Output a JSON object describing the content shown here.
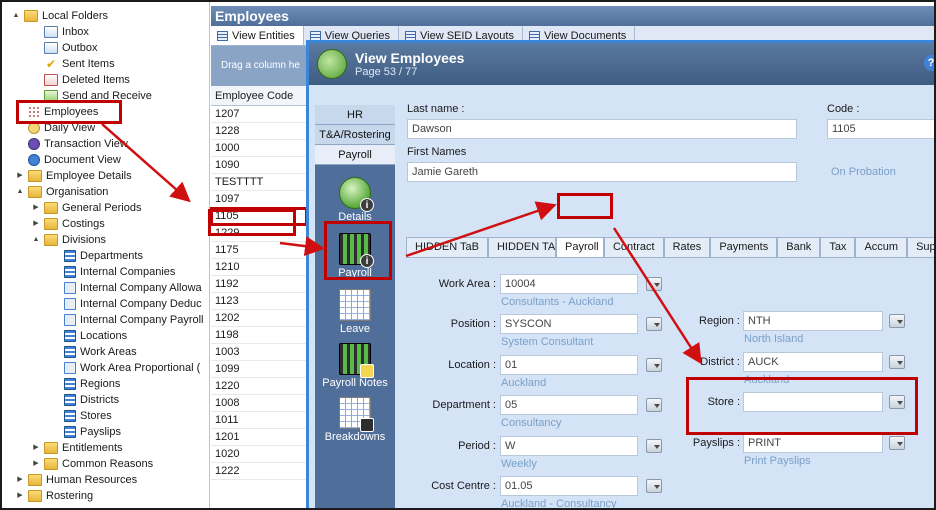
{
  "tree": {
    "items": [
      {
        "label": "Local Folders",
        "icon": "folder-icon",
        "toggle": "▲"
      },
      {
        "label": "Inbox",
        "icon": "inbox-icon",
        "toggle": ""
      },
      {
        "label": "Outbox",
        "icon": "outbox-icon",
        "toggle": ""
      },
      {
        "label": "Sent Items",
        "icon": "sent-items-icon",
        "toggle": ""
      },
      {
        "label": "Deleted Items",
        "icon": "deleted-items-icon",
        "toggle": ""
      },
      {
        "label": "Send and Receive",
        "icon": "send-receive-icon",
        "toggle": ""
      },
      {
        "label": "Employees",
        "icon": "employees-grid-icon",
        "toggle": ""
      },
      {
        "label": "Daily View",
        "icon": "clock-icon",
        "toggle": ""
      },
      {
        "label": "Transaction View",
        "icon": "transaction-icon",
        "toggle": ""
      },
      {
        "label": "Document View",
        "icon": "document-view-icon",
        "toggle": ""
      },
      {
        "label": "Employee Details",
        "icon": "folder-icon",
        "toggle": "▶"
      },
      {
        "label": "Organisation",
        "icon": "folder-icon",
        "toggle": "▲"
      },
      {
        "label": "General Periods",
        "icon": "folder-icon",
        "toggle": "▶"
      },
      {
        "label": "Costings",
        "icon": "folder-icon",
        "toggle": "▶"
      },
      {
        "label": "Divisions",
        "icon": "folder-icon",
        "toggle": "▲"
      },
      {
        "label": "Departments",
        "icon": "list-icon",
        "toggle": ""
      },
      {
        "label": "Internal Companies",
        "icon": "list-icon",
        "toggle": ""
      },
      {
        "label": "Internal Company Allowa",
        "icon": "flow-icon",
        "toggle": ""
      },
      {
        "label": "Internal Company Deduc",
        "icon": "flow-icon",
        "toggle": ""
      },
      {
        "label": "Internal Company Payroll",
        "icon": "flow-icon",
        "toggle": ""
      },
      {
        "label": "Locations",
        "icon": "list-icon",
        "toggle": ""
      },
      {
        "label": "Work Areas",
        "icon": "list-icon",
        "toggle": ""
      },
      {
        "label": "Work Area Proportional (",
        "icon": "flow-icon",
        "toggle": ""
      },
      {
        "label": "Regions",
        "icon": "list-icon",
        "toggle": ""
      },
      {
        "label": "Districts",
        "icon": "list-icon",
        "toggle": ""
      },
      {
        "label": "Stores",
        "icon": "list-icon",
        "toggle": ""
      },
      {
        "label": "Payslips",
        "icon": "list-icon",
        "toggle": ""
      },
      {
        "label": "Entitlements",
        "icon": "folder-icon",
        "toggle": "▶"
      },
      {
        "label": "Common Reasons",
        "icon": "folder-icon",
        "toggle": "▶"
      },
      {
        "label": "Human Resources",
        "icon": "folder-icon",
        "toggle": "▶"
      },
      {
        "label": "Rostering",
        "icon": "folder-icon",
        "toggle": "▶"
      }
    ]
  },
  "main": {
    "title": "Employees",
    "tabs": [
      {
        "label": "View Entities"
      },
      {
        "label": "View Queries"
      },
      {
        "label": "View SEID Layouts"
      },
      {
        "label": "View Documents"
      }
    ],
    "drag_hint": "Drag a column he",
    "column_header": "Employee Code",
    "codes": [
      "1207",
      "1228",
      "1000",
      "1090",
      "TESTTTT",
      "1097",
      "1105",
      "1229",
      "1175",
      "1210",
      "1192",
      "1123",
      "1202",
      "1198",
      "1003",
      "1099",
      "1220",
      "1008",
      "1011",
      "1201",
      "1020",
      "1222"
    ]
  },
  "dialog": {
    "title": "View Employees",
    "page": "Page 53 / 77",
    "help": "?",
    "nav_tabs": [
      "HR",
      "T&A/Rostering",
      "Payroll"
    ],
    "nav_items": [
      {
        "label": "Details",
        "icon": "details-icon"
      },
      {
        "label": "Payroll",
        "icon": "payroll-calculator-icon"
      },
      {
        "label": "Leave",
        "icon": "leave-calendar-icon"
      },
      {
        "label": "Payroll Notes",
        "icon": "payroll-notes-icon"
      },
      {
        "label": "Breakdowns",
        "icon": "breakdowns-icon"
      }
    ],
    "last_name_label": "Last name :",
    "last_name": "Dawson",
    "code_label": "Code :",
    "code": "1105",
    "first_names_label": "First Names",
    "first_names": "Jamie Gareth",
    "status": "On Probation",
    "tabs": [
      "HIDDEN TaB",
      "HIDDEN TAB",
      "Payroll",
      "Contract",
      "Rates",
      "Payments",
      "Bank",
      "Tax",
      "Accum",
      "Superar"
    ],
    "left_fields": [
      {
        "label": "Work Area :",
        "value": "10004",
        "hint": "Consultants - Auckland"
      },
      {
        "label": "Position :",
        "value": "SYSCON",
        "hint": "System Consultant"
      },
      {
        "label": "Location :",
        "value": "01",
        "hint": "Auckland"
      },
      {
        "label": "Department :",
        "value": "05",
        "hint": "Consultancy"
      },
      {
        "label": "Period :",
        "value": "W",
        "hint": "Weekly"
      },
      {
        "label": "Cost Centre :",
        "value": "01.05",
        "hint": "Auckland - Consultancy"
      }
    ],
    "right_fields": [
      {
        "label": "Region :",
        "value": "NTH",
        "hint": "North Island"
      },
      {
        "label": "District :",
        "value": "AUCK",
        "hint": "Auckland"
      },
      {
        "label": "Store :",
        "value": "",
        "hint": ""
      },
      {
        "label": "Payslips :",
        "value": "PRINT",
        "hint": "Print Payslips"
      }
    ]
  },
  "annotations": {
    "color": "#c00000"
  }
}
